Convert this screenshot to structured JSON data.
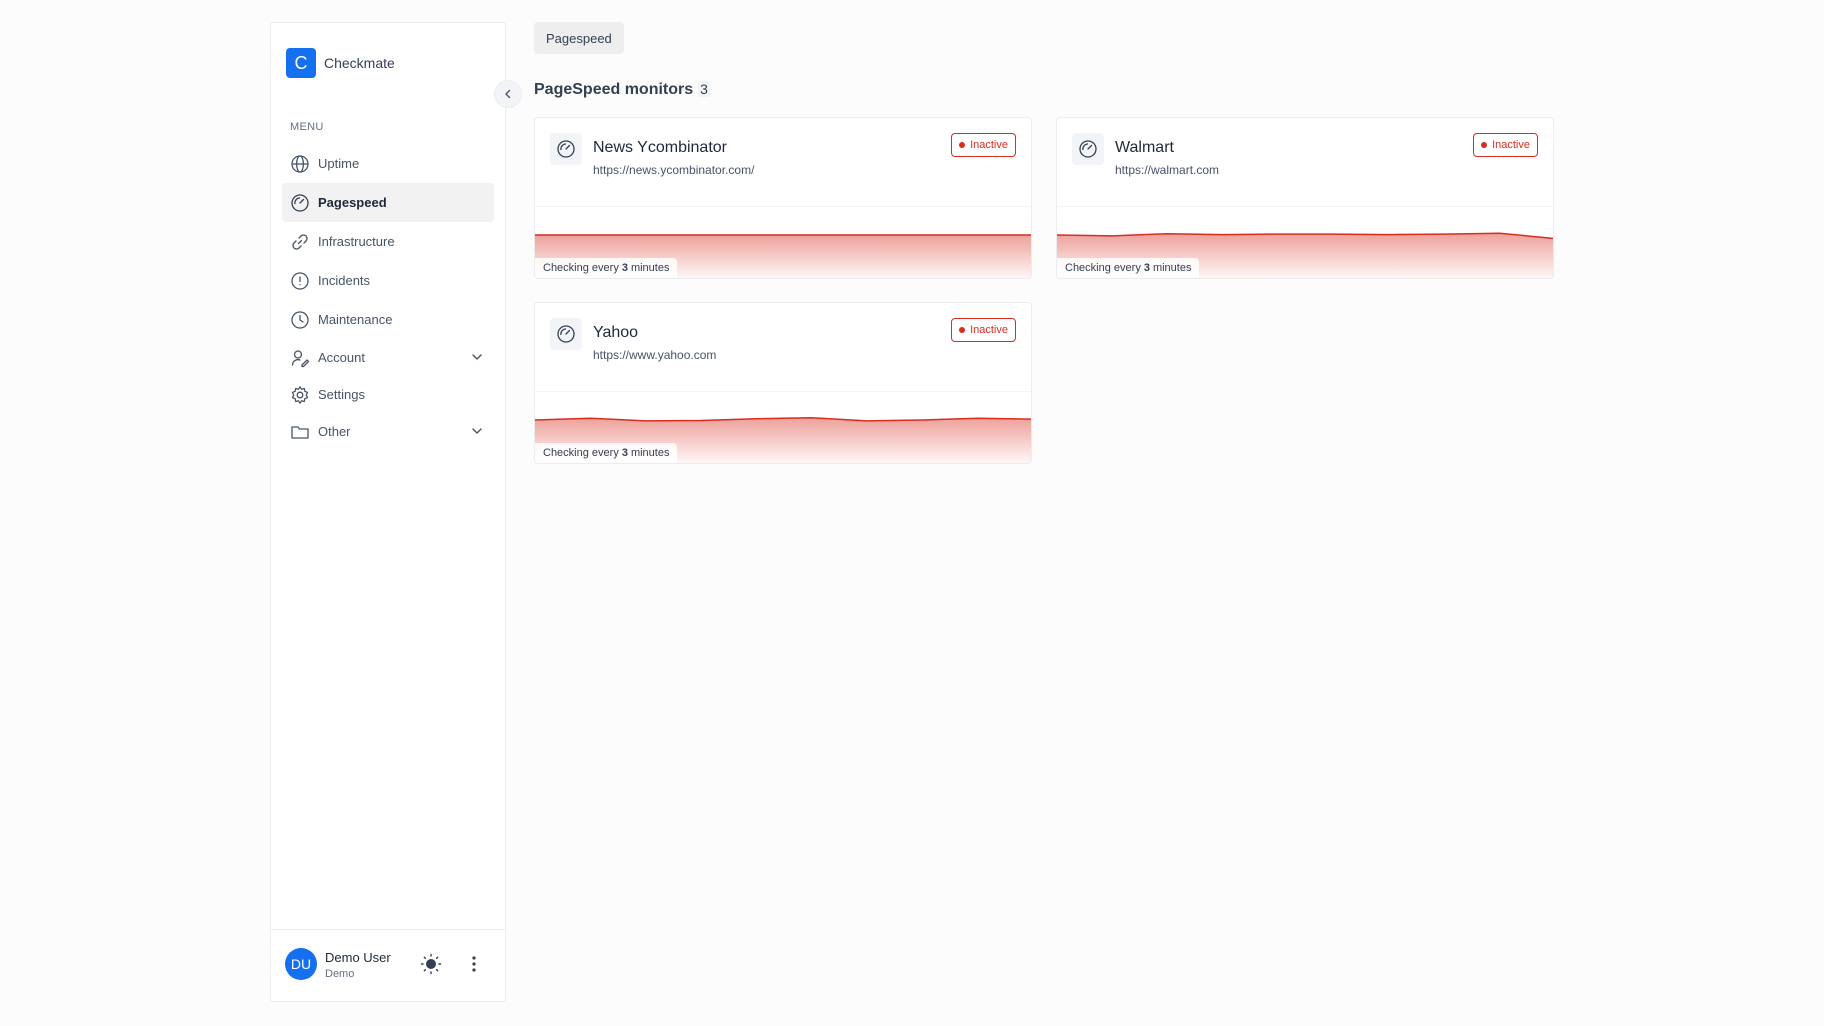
{
  "app": {
    "name": "Checkmate",
    "logo_letter": "C"
  },
  "sidebar": {
    "menu_label": "MENU",
    "items": [
      {
        "label": "Uptime",
        "icon": "globe-icon",
        "active": false
      },
      {
        "label": "Pagespeed",
        "icon": "speedometer-icon",
        "active": true
      },
      {
        "label": "Infrastructure",
        "icon": "link-icon",
        "active": false
      },
      {
        "label": "Incidents",
        "icon": "alert-circle-icon",
        "active": false
      },
      {
        "label": "Maintenance",
        "icon": "clock-icon",
        "active": false
      },
      {
        "label": "Account",
        "icon": "user-edit-icon",
        "active": false,
        "expandable": true
      },
      {
        "label": "Settings",
        "icon": "gear-icon",
        "active": false
      },
      {
        "label": "Other",
        "icon": "folder-icon",
        "active": false,
        "expandable": true
      }
    ],
    "user": {
      "initials": "DU",
      "name": "Demo User",
      "role": "Demo"
    }
  },
  "breadcrumb": {
    "label": "Pagespeed"
  },
  "page": {
    "title": "PageSpeed monitors",
    "count": "3"
  },
  "colors": {
    "accent": "#1570ef",
    "inactive": "#d92d20"
  },
  "monitors": [
    {
      "name": "News Ycombinator",
      "url": "https://news.ycombinator.com/",
      "status": "Inactive",
      "note_prefix": "Checking every",
      "note_value": "3",
      "note_suffix": "minutes"
    },
    {
      "name": "Walmart",
      "url": "https://walmart.com",
      "status": "Inactive",
      "note_prefix": "Checking every",
      "note_value": "3",
      "note_suffix": "minutes"
    },
    {
      "name": "Yahoo",
      "url": "https://www.yahoo.com",
      "status": "Inactive",
      "note_prefix": "Checking every",
      "note_value": "3",
      "note_suffix": "minutes"
    }
  ],
  "chart_data": [
    {
      "type": "area",
      "series": [
        {
          "values": [
            1,
            1,
            1,
            1,
            1,
            1,
            1,
            1,
            1,
            1
          ]
        }
      ],
      "ylim": [
        0,
        1.6
      ]
    },
    {
      "type": "area",
      "series": [
        {
          "values": [
            1.0,
            0.98,
            1.03,
            1.01,
            1.02,
            1.02,
            1.01,
            1.02,
            1.04,
            0.92
          ]
        }
      ],
      "ylim": [
        0,
        1.6
      ]
    },
    {
      "type": "area",
      "series": [
        {
          "values": [
            1.0,
            1.04,
            0.98,
            0.99,
            1.03,
            1.05,
            0.98,
            1.0,
            1.04,
            1.02
          ]
        }
      ],
      "ylim": [
        0,
        1.6
      ]
    }
  ]
}
